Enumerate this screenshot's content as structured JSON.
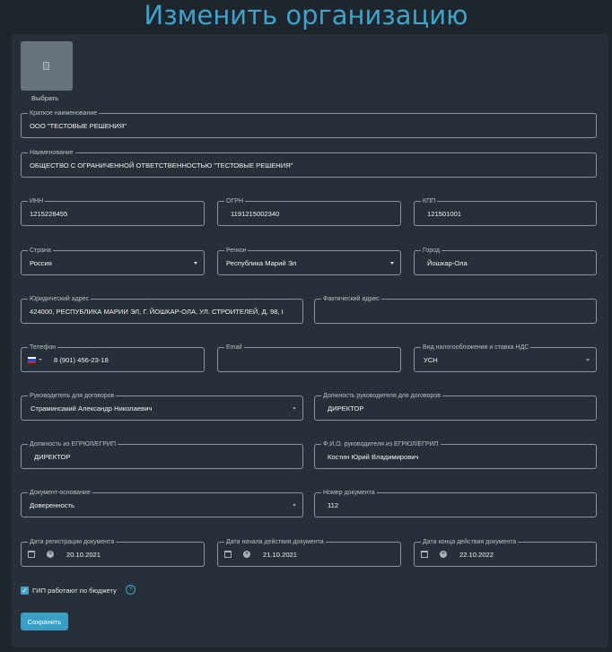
{
  "page": {
    "title": "Изменить организацию"
  },
  "avatar": {
    "pick_label": "Выбрать"
  },
  "fields": {
    "short_name": {
      "label": "Краткое наименование",
      "value": "ООО \"ТЕСТОВЫЕ РЕШЕНИЯ\""
    },
    "name": {
      "label": "Наименование",
      "value": "ОБЩЕСТВО С ОГРАНИЧЕННОЙ ОТВЕТСТВЕННОСТЬЮ \"ТЕСТОВЫЕ РЕШЕНИЯ\""
    },
    "inn": {
      "label": "ИНН",
      "value": "1215228455"
    },
    "ogrn": {
      "label": "ОГРН",
      "value": "1191215002340"
    },
    "kpp": {
      "label": "КПП",
      "value": "121501001"
    },
    "country": {
      "label": "Страна",
      "value": "Россия"
    },
    "region": {
      "label": "Регион",
      "value": "Республика Марий Эл"
    },
    "city": {
      "label": "Город",
      "value": "Йошкар-Ола"
    },
    "legal_address": {
      "label": "Юридический адрес",
      "value": "424000, РЕСПУБЛИКА МАРИИ ЭЛ, Г. ЙОШКАР-ОЛА, УЛ. СТРОИТЕЛЕЙ, Д. 98, I"
    },
    "actual_address": {
      "label": "Фактический адрес",
      "value": ""
    },
    "phone": {
      "label": "Телефон",
      "value": "8 (901) 456-23-18"
    },
    "email": {
      "label": "Email",
      "value": ""
    },
    "tax": {
      "label": "Вид налогообложения и ставка НДС",
      "value": "УСН"
    },
    "contract_head": {
      "label": "Руководитель для договоров",
      "value": "Страминсакий Александр Николаевич"
    },
    "contract_head_position": {
      "label": "Должность руководителя для договоров",
      "value": "ДИРЕКТОР"
    },
    "egrul_position": {
      "label": "Должность из ЕГРЮЛ/ЕГРИП",
      "value": "ДИРЕКТОР"
    },
    "egrul_head": {
      "label": "Ф.И.О. руководителя из ЕГРЮЛ/ЕГРИП",
      "value": "Костин Юрий Владимирович"
    },
    "basis_doc": {
      "label": "Документ-основание",
      "value": "Доверенность"
    },
    "doc_number": {
      "label": "Номер документа",
      "value": "112"
    },
    "doc_reg_date": {
      "label": "Дата регистрации документа",
      "value": "20.10.2021"
    },
    "doc_start_date": {
      "label": "Дата начала действия документа",
      "value": "21.10.2021"
    },
    "doc_end_date": {
      "label": "Дата конца действия документа",
      "value": "22.10.2022"
    }
  },
  "budget": {
    "label": "ГИП работают по бюджету",
    "checked": true
  },
  "actions": {
    "save_label": "Сохранить"
  },
  "icons": {
    "avatar": "document-icon",
    "dropdown": "chevron-down-icon",
    "calendar": "calendar-icon",
    "clear": "clear-icon",
    "flag": "russia-flag-icon",
    "help": "help-icon",
    "check": "checkmark-icon"
  },
  "colors": {
    "accent": "#3fa3c9",
    "background": "#1e252c",
    "panel": "#273038",
    "border": "#8b949c"
  }
}
